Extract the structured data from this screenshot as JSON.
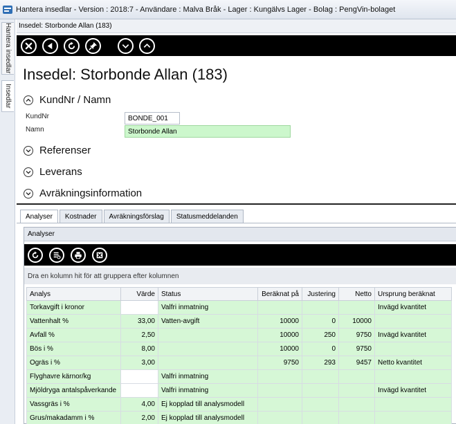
{
  "window": {
    "title": "Hantera insedlar - Version : 2018:7 - Användare : Malva Bråk - Lager : Kungälvs Lager  - Bolag : PengVin-bolaget"
  },
  "rail": {
    "tabs": [
      "Hantera insedlar",
      "Insedlar"
    ]
  },
  "doc_header": "Insedel: Storbonde Allan (183)",
  "toolbar": {
    "icons": [
      "close-icon",
      "back-icon",
      "refresh-icon",
      "pin-icon",
      "chevron-down-icon",
      "chevron-up-icon"
    ]
  },
  "page": {
    "title": "Insedel: Storbonde Allan (183)"
  },
  "sections": {
    "kund": "KundNr / Namn",
    "referenser": "Referenser",
    "leverans": "Leverans",
    "avrakning": "Avräkningsinformation"
  },
  "fields": {
    "kundnr_label": "KundNr",
    "kundnr_value": "BONDE_001",
    "namn_label": "Namn",
    "namn_value": "Storbonde Allan"
  },
  "tabs": [
    "Analyser",
    "Kostnader",
    "Avräkningsförslag",
    "Statusmeddelanden"
  ],
  "panel": {
    "header": "Analyser",
    "group_hint": "Dra en kolumn hit för att gruppera efter kolumnen",
    "toolbar_icons": [
      "refresh-icon",
      "list-settings-icon",
      "print-icon",
      "export-excel-icon"
    ]
  },
  "grid": {
    "columns": [
      "Analys",
      "Värde",
      "Status",
      "Beräknat på",
      "Justering",
      "Netto",
      "Ursprung beräknat"
    ],
    "rows": [
      [
        "Torkavgift i kronor",
        "",
        "Valfri inmatning",
        "",
        "",
        "",
        "Invägd kvantitet"
      ],
      [
        "Vattenhalt %",
        "33,00",
        "Vatten-avgift",
        "10000",
        "0",
        "10000",
        ""
      ],
      [
        "Avfall %",
        "2,50",
        "",
        "10000",
        "250",
        "9750",
        "Invägd kvantitet"
      ],
      [
        "Bös i %",
        "8,00",
        "",
        "10000",
        "0",
        "9750",
        ""
      ],
      [
        "Ogräs i %",
        "3,00",
        "",
        "9750",
        "293",
        "9457",
        "Netto kvantitet"
      ],
      [
        "Flyghavre kärnor/kg",
        "",
        "Valfri inmatning",
        "",
        "",
        "",
        ""
      ],
      [
        "Mjöldryga antalspåverkande",
        "",
        "Valfri inmatning",
        "",
        "",
        "",
        "Invägd kvantitet"
      ],
      [
        "Vassgräs i %",
        "4,00",
        "Ej kopplad till analysmodell",
        "",
        "",
        "",
        ""
      ],
      [
        "Grus/makadamm i %",
        "2,00",
        "Ej kopplad till analysmodell",
        "",
        "",
        "",
        ""
      ]
    ]
  },
  "colors": {
    "row_green": "#d6f7d6",
    "toolbar_bg": "#000000"
  }
}
